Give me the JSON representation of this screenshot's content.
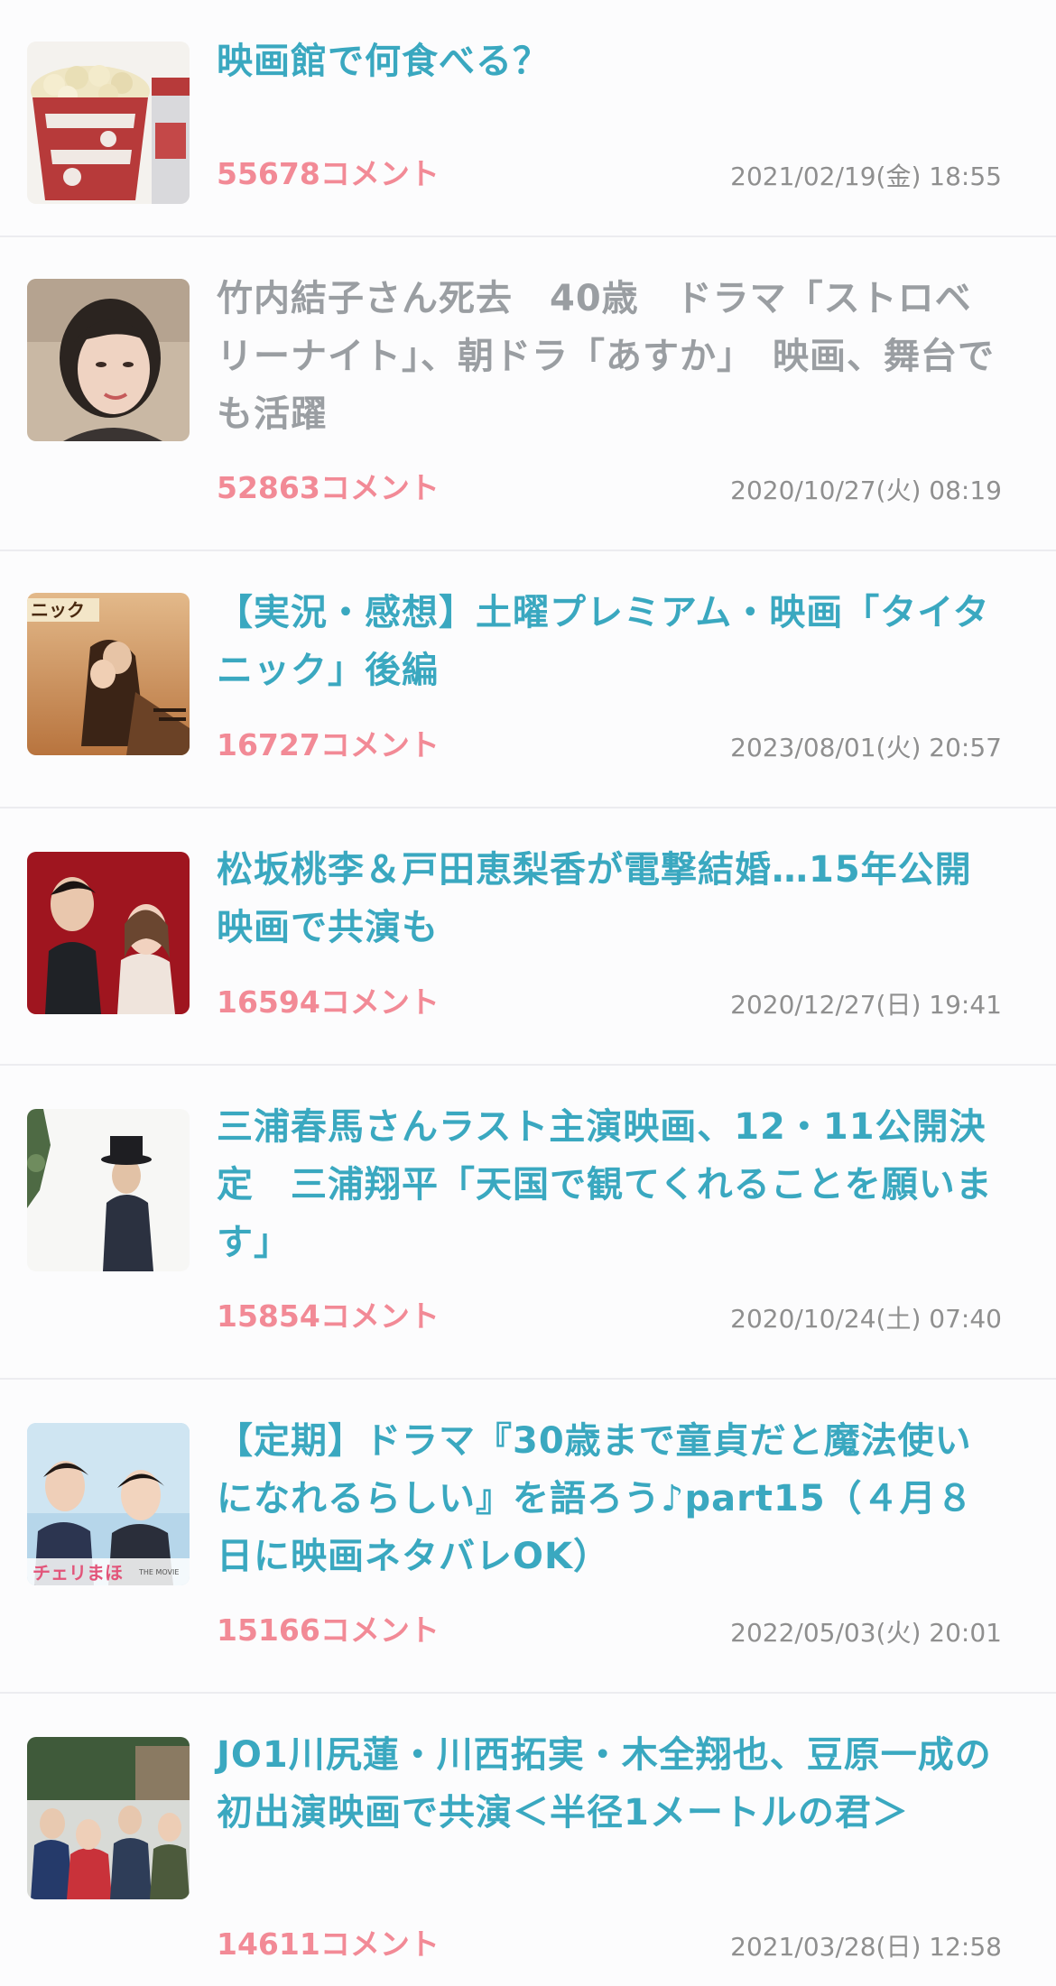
{
  "comment_suffix": "コメント",
  "topics": [
    {
      "title": "映画館で何食べる？",
      "count": "55678",
      "date": "2021/02/19(金) 18:55",
      "visited": false,
      "thumb_icon": "popcorn-image"
    },
    {
      "title": "竹内結子さん死去　40歳　ドラマ「ストロベリーナイト」、朝ドラ「あすか」　映画、舞台でも活躍",
      "count": "52863",
      "date": "2020/10/27(火) 08:19",
      "visited": true,
      "thumb_icon": "portrait-image"
    },
    {
      "title": "【実況・感想】土曜プレミアム・映画「タイタニック」後編",
      "count": "16727",
      "date": "2023/08/01(火) 20:57",
      "visited": false,
      "thumb_icon": "movie-poster-image"
    },
    {
      "title": "松坂桃李＆戸田恵梨香が電撃結婚…15年公開映画で共演も",
      "count": "16594",
      "date": "2020/12/27(日) 19:41",
      "visited": false,
      "thumb_icon": "couple-photo-image"
    },
    {
      "title": "三浦春馬さんラスト主演映画、12・11公開決定　三浦翔平「天国で観てくれることを願います」",
      "count": "15854",
      "date": "2020/10/24(土) 07:40",
      "visited": false,
      "thumb_icon": "man-in-hat-image"
    },
    {
      "title": "【定期】ドラマ『30歳まで童貞だと魔法使いになれるらしい』を語ろう♪part15（４月８日に映画ネタバレOK）",
      "count": "15166",
      "date": "2022/05/03(火) 20:01",
      "visited": false,
      "thumb_icon": "drama-poster-image",
      "thumb_caption": "チェリまほ",
      "thumb_caption_small": "THE MOVIE"
    },
    {
      "title": "JO1川尻蓮・川西拓実・木全翔也、豆原一成の初出演映画で共演＜半径1メートルの君＞",
      "count": "14611",
      "date": "2021/03/28(日) 12:58",
      "visited": false,
      "thumb_icon": "group-photo-image"
    }
  ]
}
